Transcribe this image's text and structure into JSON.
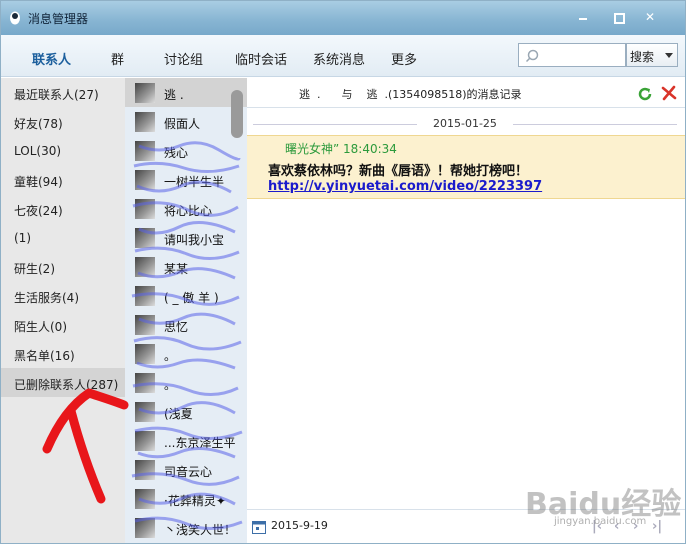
{
  "window": {
    "title": "消息管理器"
  },
  "tabs": [
    {
      "label": "联系人",
      "active": true
    },
    {
      "label": "群"
    },
    {
      "label": "讨论组"
    },
    {
      "label": "临时会话"
    },
    {
      "label": "系统消息"
    },
    {
      "label": "更多"
    }
  ],
  "search": {
    "placeholder": "",
    "button_label": "搜索"
  },
  "categories": [
    "最近联系人(27)",
    "好友(78)",
    "LOL(30)",
    "童鞋(94)",
    "七夜(24)",
    "(1)",
    "研生(2)",
    "生活服务(4)",
    "陌生人(0)",
    "黑名单(16)",
    "已删除联系人(287)"
  ],
  "selected_category_index": 10,
  "contacts": [
    {
      "name": "逃  ."
    },
    {
      "name": "假面人"
    },
    {
      "name": "残心"
    },
    {
      "name": "一树半生半"
    },
    {
      "name": "将心比心"
    },
    {
      "name": "请叫我小宝"
    },
    {
      "name": "某某"
    },
    {
      "name": "( _ 傲 羊 )"
    },
    {
      "name": "思忆"
    },
    {
      "name": "。"
    },
    {
      "name": "。"
    },
    {
      "name": "(浅夏"
    },
    {
      "name": "...东京泽生平"
    },
    {
      "name": "司音云心"
    },
    {
      "name": "·花葬精灵✦"
    },
    {
      "name": "丶浅笑人世！"
    }
  ],
  "chat": {
    "header_title": "逃  .      与    逃  .(1354098518)的消息记录",
    "date_separator": "2015-01-25",
    "message": {
      "sender_time": "曙光女神” 18:40:34",
      "text": "喜欢蔡依林吗？新曲《唇语》！帮她打榜吧！",
      "link": "http://v.yinyuetai.com/video/2223397"
    },
    "footer_date": "2015-9-19"
  },
  "watermark": {
    "main": "Baidu经验",
    "sub": "jingyan.baidu.com"
  },
  "colors": {
    "accent": "#1c5f9d",
    "message_bg": "#fcf1cf",
    "sender": "#2c9a3c",
    "link": "#1b1bcc"
  }
}
